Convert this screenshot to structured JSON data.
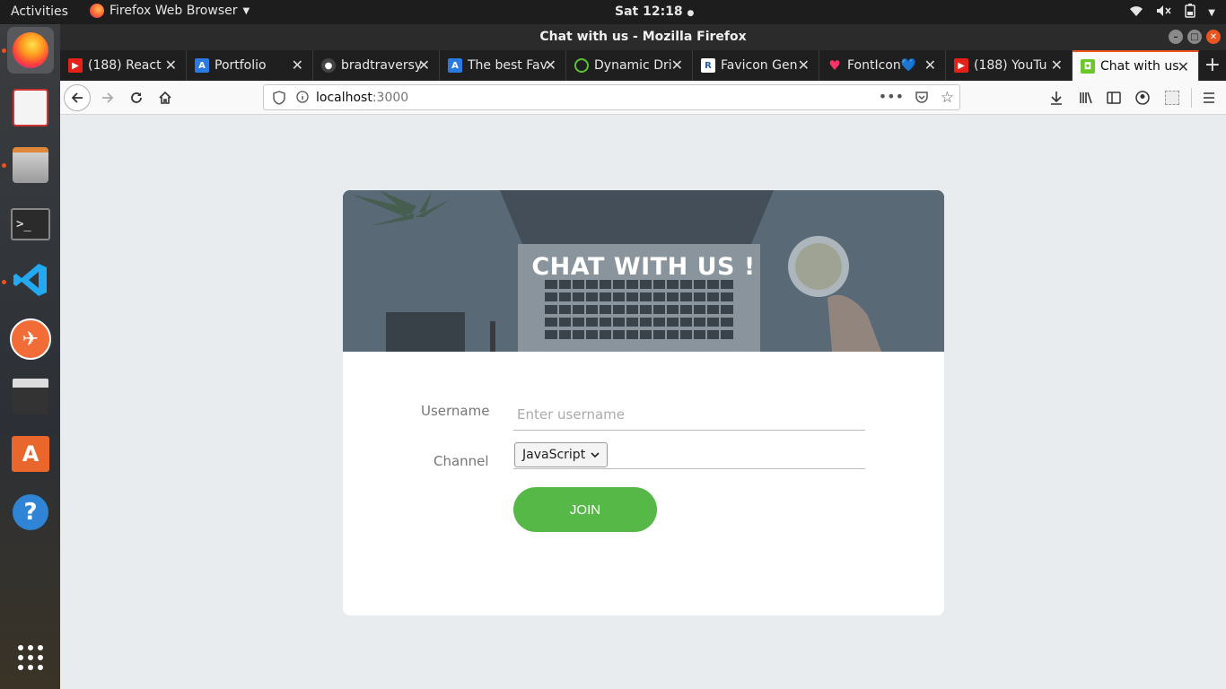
{
  "topbar": {
    "activities": "Activities",
    "app_name": "Firefox Web Browser",
    "clock": "Sat 12:18"
  },
  "window": {
    "title": "Chat with us - Mozilla Firefox"
  },
  "tabs": [
    {
      "label": "(188) React",
      "icon": "youtube-icon"
    },
    {
      "label": "Portfolio",
      "icon": "portfolio-icon"
    },
    {
      "label": "bradtraversy",
      "icon": "github-icon"
    },
    {
      "label": "The best Fav",
      "icon": "portfolio-icon"
    },
    {
      "label": "Dynamic Dri",
      "icon": "dynamic-drive-icon"
    },
    {
      "label": "Favicon Gen",
      "icon": "realfavicon-icon"
    },
    {
      "label": "FontIcon💙",
      "icon": "heart-icon"
    },
    {
      "label": "(188) YouTu",
      "icon": "youtube-icon"
    },
    {
      "label": "Chat with us",
      "icon": "chat-favicon-icon",
      "selected": true
    }
  ],
  "navbar": {
    "url_host": "localhost",
    "url_port": ":3000"
  },
  "page": {
    "hero_title": "CHAT WITH US !",
    "username_label": "Username",
    "username_placeholder": "Enter username",
    "username_value": "",
    "channel_label": "Channel",
    "channel_selected": "JavaScript",
    "join_label": "JOIN"
  },
  "colors": {
    "accent": "#e95420",
    "join_button": "#56b947",
    "page_bg": "#e9ecee"
  }
}
